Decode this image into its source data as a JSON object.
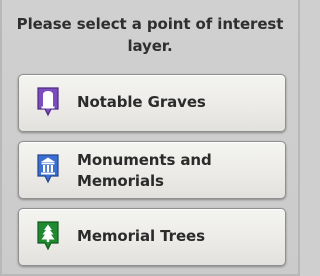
{
  "prompt": {
    "text": "Please select a point of interest layer."
  },
  "layers": [
    {
      "label": "Notable Graves",
      "icon": "grave-marker-icon",
      "color": "#7c4dbd"
    },
    {
      "label": "Monuments and Memorials",
      "icon": "monument-marker-icon",
      "color": "#3a6fd1"
    },
    {
      "label": "Memorial Trees",
      "icon": "tree-marker-icon",
      "color": "#1f8a2f"
    }
  ]
}
